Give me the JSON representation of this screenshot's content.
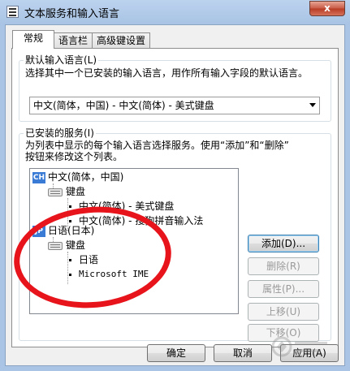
{
  "window": {
    "title": "文本服务和输入语言",
    "close_label": "x"
  },
  "tabs": [
    {
      "label": "常规",
      "active": true
    },
    {
      "label": "语言栏",
      "active": false
    },
    {
      "label": "高级键设置",
      "active": false
    }
  ],
  "default_input": {
    "group_title": "默认输入语言(L)",
    "description": "选择其中一个已安装的输入语言，用作所有输入字段的默认语言。",
    "selected": "中文(简体，中国) - 中文(简体) - 美式键盘"
  },
  "installed": {
    "group_title": "已安装的服务(I)",
    "description_line1": "为列表中显示的每个输入语言选择服务。使用“添加”和“删除”",
    "description_line2": "按钮来修改这个列表。",
    "tree": [
      {
        "label": "中文(简体，中国)",
        "badge": "CH",
        "keyboard_label": "键盘",
        "items": [
          "中文(简体) - 美式键盘",
          "中文(简体) - 搜狗拼音输入法"
        ]
      },
      {
        "label": "日语(日本)",
        "badge": "JP",
        "keyboard_label": "键盘",
        "items": [
          "日语",
          "Microsoft IME"
        ]
      }
    ]
  },
  "side_buttons": {
    "add": "添加(D)...",
    "remove": "删除(R)",
    "properties": "属性(P)...",
    "move_up": "上移(U)",
    "move_down": "下移(O)"
  },
  "footer_buttons": {
    "ok": "确定",
    "cancel": "取消",
    "apply": "应用(A)"
  },
  "colors": {
    "annotation": "#e8141b",
    "lang_badge": "#3a7bd5"
  }
}
